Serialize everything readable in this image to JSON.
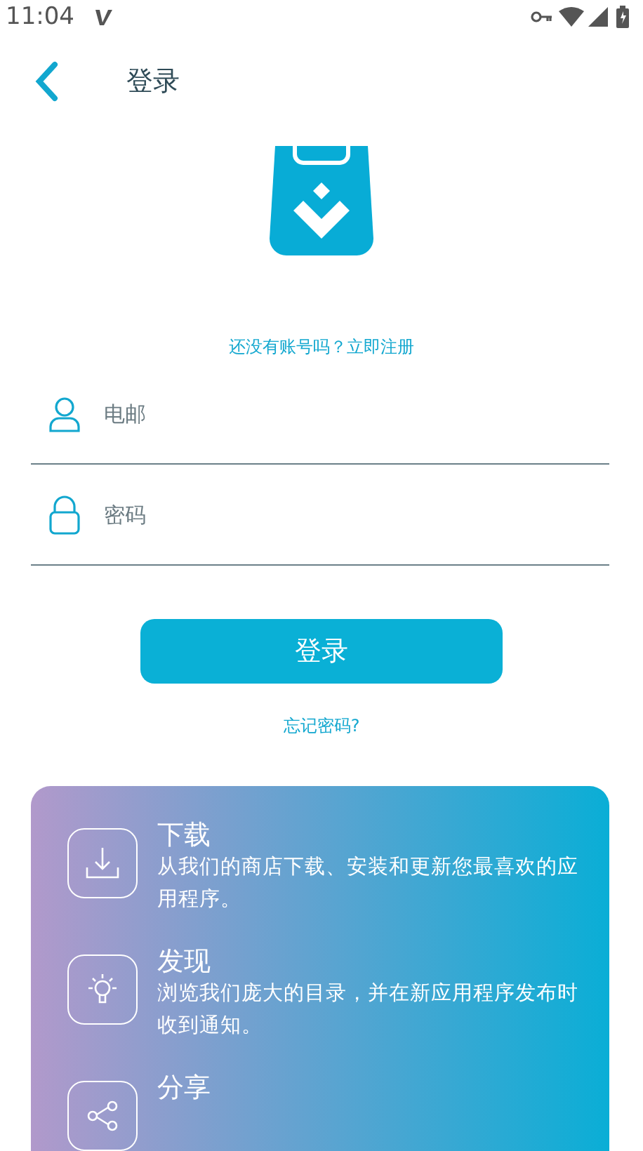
{
  "status_bar": {
    "time": "11:04"
  },
  "header": {
    "title": "登录"
  },
  "register_link": "还没有账号吗？立即注册",
  "fields": [
    {
      "kind": "user",
      "placeholder": "电邮"
    },
    {
      "kind": "lock",
      "placeholder": "密码"
    }
  ],
  "login_button": "登录",
  "forgot_link": "忘记密码?",
  "features": [
    {
      "kind": "download",
      "title": "下载",
      "text": "从我们的商店下载、安装和更新您最喜欢的应用程序。"
    },
    {
      "kind": "bulb",
      "title": "发现",
      "text": "浏览我们庞大的目录，并在新应用程序发布时收到通知。"
    },
    {
      "kind": "share",
      "title": "分享"
    }
  ]
}
